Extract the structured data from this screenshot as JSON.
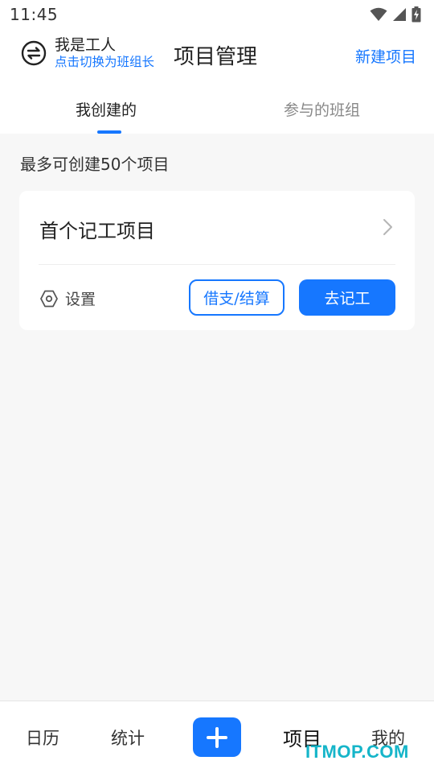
{
  "status_bar": {
    "time": "11:45"
  },
  "header": {
    "role_name": "我是工人",
    "role_switch_hint": "点击切换为班组长",
    "title": "项目管理",
    "new_project_label": "新建项目"
  },
  "tabs": [
    {
      "label": "我创建的",
      "active": true
    },
    {
      "label": "参与的班组",
      "active": false
    }
  ],
  "limit_text": "最多可创建50个项目",
  "project_card": {
    "title": "首个记工项目",
    "settings_label": "设置",
    "loan_button_label": "借支/结算",
    "record_button_label": "去记工"
  },
  "bottom_nav": [
    {
      "label": "日历"
    },
    {
      "label": "统计"
    },
    {
      "label": "项目",
      "active": true
    },
    {
      "label": "我的"
    }
  ],
  "watermark": "ITMOP.COM",
  "colors": {
    "accent": "#1677ff",
    "background": "#f7f7f7",
    "card": "#ffffff",
    "watermark": "#15b5c9"
  },
  "icons": [
    "wifi-icon",
    "signal-icon",
    "battery-icon",
    "switch-role-icon",
    "chevron-right-icon",
    "settings-icon",
    "plus-icon"
  ]
}
